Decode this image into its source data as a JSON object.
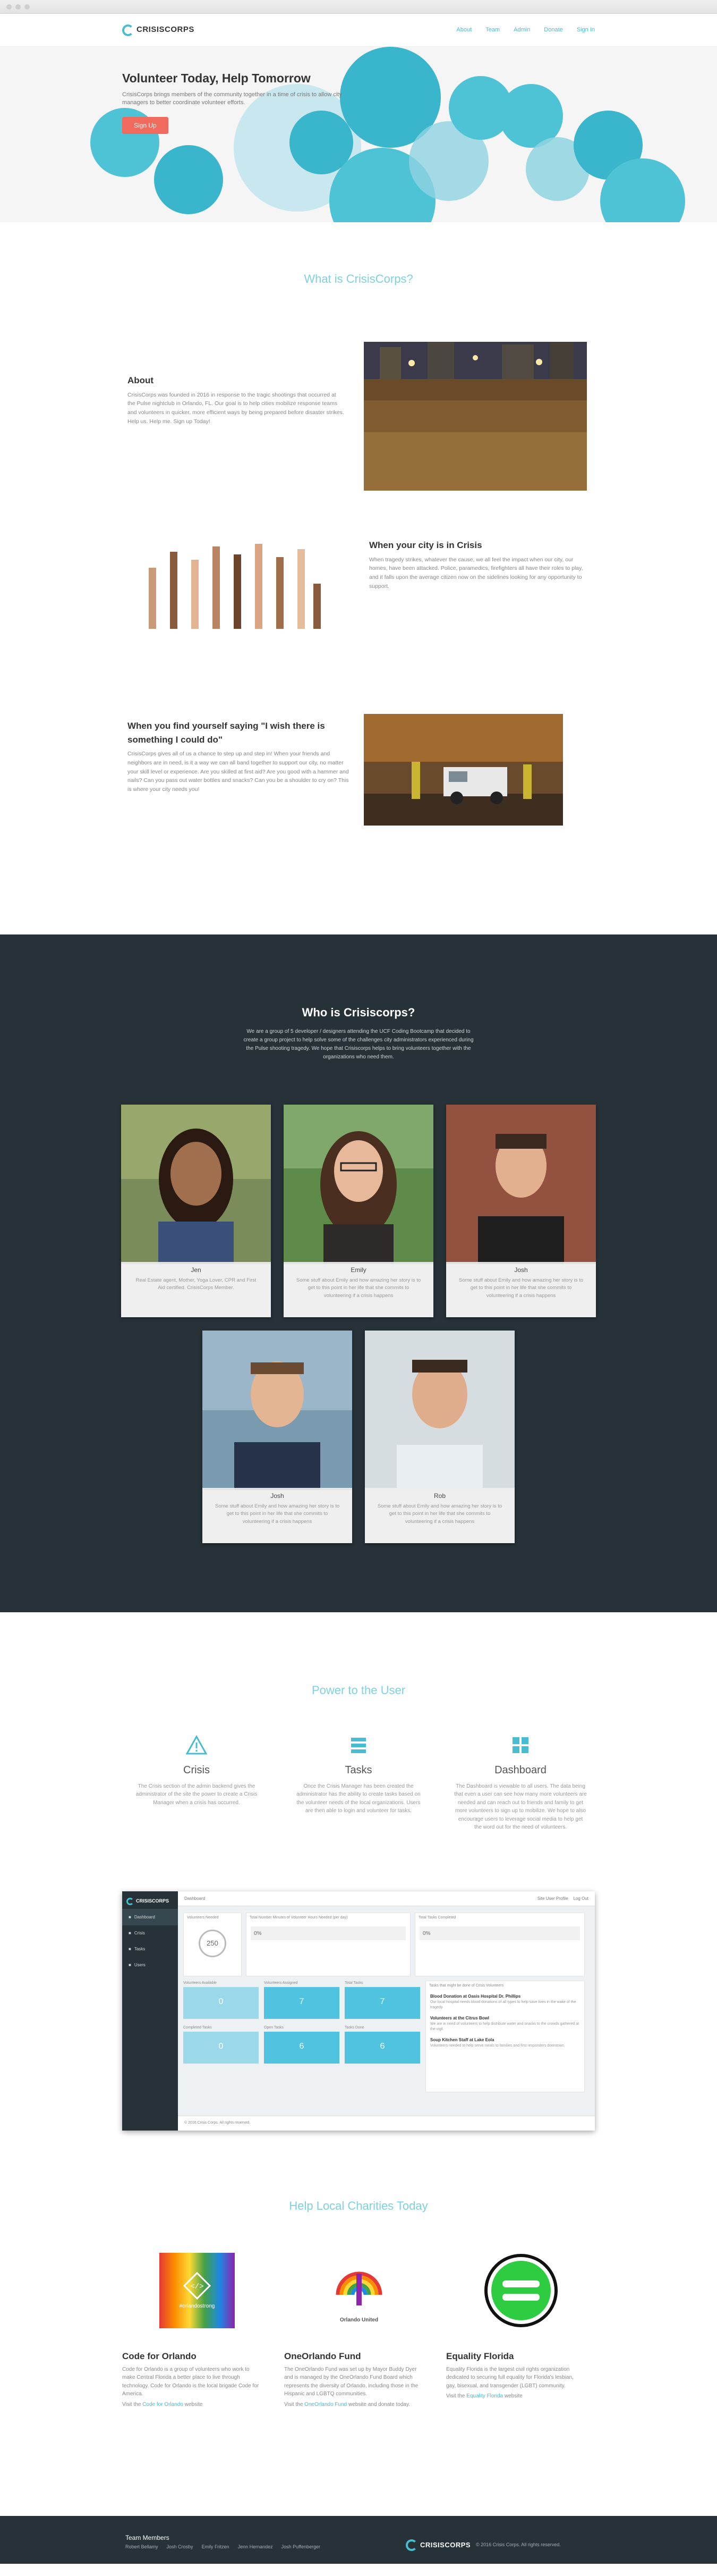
{
  "nav": {
    "logo": "CRISISCORPS",
    "links": [
      "About",
      "Team",
      "Admin",
      "Donate",
      "Sign In"
    ]
  },
  "hero": {
    "title": "Volunteer Today, Help Tomorrow",
    "subtitle": "CrisisCorps brings members of the community together in a time of crisis to allow city managers to better coordinate volunteer efforts.",
    "cta": "Sign Up"
  },
  "what": {
    "heading": "What is CrisisCorps?",
    "about": {
      "title": "About",
      "text": "CrisisCorps was founded in 2016 in response to the tragic shootings that occurred at the Pulse nightclub in Orlando, FL. Our goal is to help cities mobilize response teams and volunteers in quicker, more efficient ways by being prepared before disaster strikes. Help us. Help me. Sign up Today!"
    },
    "city": {
      "title": "When your city is in Crisis",
      "text": "When tragedy strikes, whatever the cause, we all feel the impact when our city, our homes, have been attacked. Police, paramedics, firefighters all have their roles to play, and it falls upon the average citizen now on the sidelines looking for any opportunity to support."
    },
    "wish": {
      "title": "When you find yourself saying \"I wish there is something I could do\"",
      "text": "CrisisCorps gives all of us a chance to step up and step in! When your friends and neighbors are in need, is it a way we can all band together to support our city, no matter your skill level or experience. Are you skilled at first aid? Are you good with a hammer and nails? Can you pass out water bottles and snacks? Can you be a shoulder to cry on? This is where your city needs you!"
    }
  },
  "who": {
    "heading": "Who is Crisiscorps?",
    "description": "We are a group of 5 developer / designers attending the UCF Coding Bootcamp that decided to create a group project to help solve some of the challenges city administrators experienced during the Pulse shooting tragedy. We hope that Crisiscorps helps to bring volunteers together with the organizations who need them.",
    "members": [
      {
        "name": "Jen",
        "text": "Real Estate agent, Mother, Yoga Lover, CPR and First Aid certified. CrisisCorps Member."
      },
      {
        "name": "Emily",
        "text": "Some stuff about Emily and how amazing her story is to get to this point in her life that she commits to volunteering if a crisis happens"
      },
      {
        "name": "Josh",
        "text": "Some stuff about Emily and how amazing her story is to get to this point in her life that she commits to volunteering if a crisis happens"
      },
      {
        "name": "Josh",
        "text": "Some stuff about Emily and how amazing her story is to get to this point in her life that she commits to volunteering if a crisis happens"
      },
      {
        "name": "Rob",
        "text": "Some stuff about Emily and how amazing her story is to get to this point in her life that she commits to volunteering if a crisis happens"
      }
    ]
  },
  "power": {
    "heading": "Power to the User",
    "features": [
      {
        "title": "Crisis",
        "text": "The Crisis section of the admin backend gives the administrator of the site the power to create a Crisis Manager when a crisis has occurred."
      },
      {
        "title": "Tasks",
        "text": "Once the Crisis Manager has been created the administrator has the ability to create tasks based on the volunteer needs of the local organizations. Users are then able to login and volunteer for tasks."
      },
      {
        "title": "Dashboard",
        "text": "The Dashboard is viewable to all users. The data being that even a user can see how many more volunteers are needed and can reach out to friends and family to get more volunteers to sign up to mobilize. We hope to also encourage users to leverage social media to help get the word out for the need of volunteers."
      }
    ],
    "dashboard": {
      "logo": "CRISISCORPS",
      "menu": [
        "Dashboard",
        "Crisis",
        "Tasks",
        "Users"
      ],
      "topbar": "Dashboard",
      "topbar_right": [
        "Site User Profile",
        "Log Out"
      ],
      "panels": {
        "volunteers_label": "Volunteers Needed",
        "volunteers_value": "250",
        "progress1_label": "Total Number Minutes of Volunteer Hours Needed (per day)",
        "progress1_value": "0%",
        "progress2_label": "Total Tasks Completed",
        "progress2_value": "0%",
        "news_label": "Tasks that might be done of Crisis Volunteers",
        "news": [
          {
            "title": "Blood Donation at Oasis Hospital Dr. Phillips",
            "text": "Our local hospital needs blood donations of all types to help save lives in the wake of the tragedy."
          },
          {
            "title": "Volunteers at the Citrus Bowl",
            "text": "We are in need of volunteers to help distribute water and snacks to the crowds gathered at the vigil."
          },
          {
            "title": "Soup Kitchen Staff at Lake Eola",
            "text": "Volunteers needed to help serve meals to families and first responders downtown."
          }
        ]
      },
      "tiles": [
        {
          "label": "Volunteers Available",
          "value": "0"
        },
        {
          "label": "Volunteers Assigned",
          "value": "7"
        },
        {
          "label": "Total Tasks",
          "value": "7"
        },
        {
          "label": "Completed Tasks",
          "value": "0"
        },
        {
          "label": "Open Tasks",
          "value": "6"
        },
        {
          "label": "Tasks Done",
          "value": "6"
        }
      ],
      "footer": "© 2016 Crisis Corps. All rights reserved."
    }
  },
  "charities": {
    "heading": "Help Local Charities Today",
    "items": [
      {
        "title": "Code for Orlando",
        "text": "Code for Orlando is a group of volunteers who work to make Central Florida a better place to live through technology. Code for Orlando is the local brigade Code for America.",
        "visit": "Visit the",
        "link": "Code for Orlando",
        "after": "website",
        "logo_text": "#orlandostrong"
      },
      {
        "title": "OneOrlando Fund",
        "text": "The OneOrlando Fund was set up by Mayor Buddy Dyer and is managed by the OneOrlando Fund Board which represents the diversity of Orlando, including those in the Hispanic and LGBTQ communities.",
        "visit": "Visit the",
        "link": "OneOrlando Fund",
        "after": "website and donate today.",
        "logo_text": "Orlando United"
      },
      {
        "title": "Equality Florida",
        "text": "Equality Florida is the largest civil rights organization dedicated to securing full equality for Florida's lesbian, gay, bisexual, and transgender (LGBT) community.",
        "visit": "Visit the",
        "link": "Equality Florida",
        "after": "website",
        "logo_text": ""
      }
    ]
  },
  "footer": {
    "title": "Team Members",
    "members": [
      "Robert Bellamy",
      "Josh Crosby",
      "Emily Fritzen",
      "Jenn Hernandez",
      "Josh Puffenberger"
    ],
    "logo": "CRISISCORPS",
    "copyright": "© 2016 Crisis Corps. All rights reserved."
  },
  "colors": {
    "accent": "#48bcd1",
    "cta": "#f06a5d",
    "dark": "#263238",
    "heading": "#7fd0e0"
  }
}
